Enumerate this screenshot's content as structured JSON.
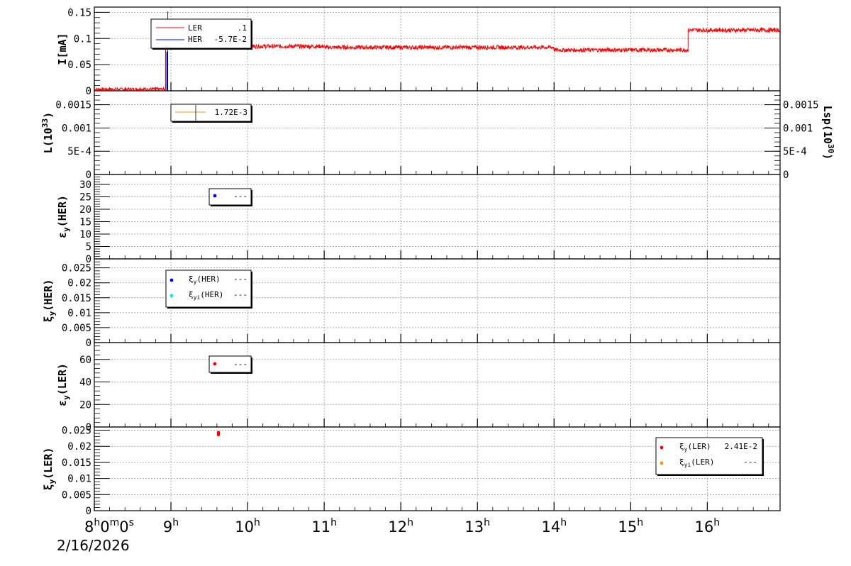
{
  "chart_data": [
    {
      "type": "line",
      "ylabel": "I[mA]",
      "ylim": [
        0,
        0.16
      ],
      "yticks": [
        "0",
        "0.05",
        "0.1",
        "0.15"
      ],
      "ytick_values": [
        0,
        0.05,
        0.1,
        0.15
      ],
      "grid": true,
      "legend": "top-left",
      "series": [
        {
          "name": "LER",
          "value_label": ".1",
          "color": "#ff0000",
          "segments": [
            {
              "x_start": 8.0,
              "x_end": 8.93,
              "mean": 0.003,
              "noise": 0.003
            },
            {
              "x_start": 8.93,
              "x_end": 9.02,
              "mean": 0.083,
              "noise": 0.004
            },
            {
              "x_start": 9.02,
              "x_end": 11.0,
              "mean": 0.085,
              "noise": 0.004
            },
            {
              "x_start": 11.0,
              "x_end": 14.0,
              "mean": 0.083,
              "noise": 0.004
            },
            {
              "x_start": 14.0,
              "x_end": 15.75,
              "mean": 0.078,
              "noise": 0.004
            },
            {
              "x_start": 15.75,
              "x_end": 16.95,
              "mean": 0.116,
              "noise": 0.004
            }
          ]
        },
        {
          "name": "HER",
          "value_label": "-5.7E-2",
          "color": "#0000ff",
          "spike_x": 8.95,
          "spike_top": 0.075
        }
      ]
    },
    {
      "type": "line",
      "ylabel": "L(10",
      "ylabel_sup": "33",
      "ylabel_tail": ")",
      "ylim": [
        0,
        0.0018
      ],
      "yticks": [
        "0",
        "5E-4",
        "0.001",
        "0.0015"
      ],
      "ytick_values": [
        0,
        0.0005,
        0.001,
        0.0015
      ],
      "y2label": "Lsp(10",
      "y2label_sup": "30",
      "y2label_tail": ")",
      "y2ticks": [
        "0",
        "5E-4",
        "0.001",
        "0.0015"
      ],
      "grid": true,
      "series": [
        {
          "name": "",
          "value_label": "1.72E-3",
          "color": "#e8a000"
        }
      ]
    },
    {
      "type": "scatter",
      "ylabel": "ε",
      "ylabel_sub": "y",
      "ylabel_tail": "(HER)",
      "ylim": [
        0,
        34
      ],
      "yticks": [
        "0",
        "5",
        "10",
        "15",
        "20",
        "25",
        "30"
      ],
      "ytick_values": [
        0,
        5,
        10,
        15,
        20,
        25,
        30
      ],
      "grid": true,
      "series": [
        {
          "name": "",
          "value_label": "---",
          "color": "#0000ff",
          "points": []
        }
      ]
    },
    {
      "type": "scatter",
      "ylabel": "ξ",
      "ylabel_sub": "y",
      "ylabel_tail": "(HER)",
      "ylim": [
        0,
        0.028
      ],
      "yticks": [
        "0",
        "0.005",
        "0.01",
        "0.015",
        "0.02",
        "0.025"
      ],
      "ytick_values": [
        0,
        0.005,
        0.01,
        0.015,
        0.02,
        0.025
      ],
      "grid": true,
      "series": [
        {
          "name": "ξ",
          "name_sub": "y",
          "name_tail": "(HER)",
          "value_label": "---",
          "color": "#0000ff",
          "points": []
        },
        {
          "name": "ξ",
          "name_sub": "yi",
          "name_tail": "(HER)",
          "value_label": "---",
          "color": "#00e5ee",
          "points": []
        }
      ]
    },
    {
      "type": "scatter",
      "ylabel": "ε",
      "ylabel_sub": "y",
      "ylabel_tail": "(LER)",
      "ylim": [
        0,
        75
      ],
      "yticks": [
        "0",
        "20",
        "40",
        "60"
      ],
      "ytick_values": [
        0,
        20,
        40,
        60
      ],
      "grid": true,
      "series": [
        {
          "name": "",
          "value_label": "---",
          "color": "#ff0000",
          "points": []
        }
      ]
    },
    {
      "type": "scatter",
      "ylabel": "ξ",
      "ylabel_sub": "y",
      "ylabel_tail": "(LER)",
      "ylim": [
        0,
        0.026
      ],
      "yticks": [
        "0",
        "0.005",
        "0.01",
        "0.015",
        "0.02",
        "0.025"
      ],
      "ytick_values": [
        0,
        0.005,
        0.01,
        0.015,
        0.02,
        0.025
      ],
      "grid": true,
      "series": [
        {
          "name": "ξ",
          "name_sub": "y",
          "name_tail": "(LER)",
          "value_label": "2.41E-2",
          "color": "#ff0000",
          "points": [
            [
              9.62,
              0.0236
            ],
            [
              9.62,
              0.024
            ],
            [
              9.62,
              0.0243
            ]
          ]
        },
        {
          "name": "ξ",
          "name_sub": "yi",
          "name_tail": "(LER)",
          "value_label": "---",
          "color": "#e8a000",
          "points": []
        }
      ]
    }
  ],
  "x_axis": {
    "xlim": [
      8.0,
      16.95
    ],
    "ticks": [
      {
        "x": 8,
        "label": "8",
        "sup": "h",
        "rest": "0",
        "sup2": "m",
        "rest2": "0",
        "sup3": "s"
      },
      {
        "x": 9,
        "label": "9",
        "sup": "h"
      },
      {
        "x": 10,
        "label": "10",
        "sup": "h"
      },
      {
        "x": 11,
        "label": "11",
        "sup": "h"
      },
      {
        "x": 12,
        "label": "12",
        "sup": "h"
      },
      {
        "x": 13,
        "label": "13",
        "sup": "h"
      },
      {
        "x": 14,
        "label": "14",
        "sup": "h"
      },
      {
        "x": 15,
        "label": "15",
        "sup": "h"
      },
      {
        "x": 16,
        "label": "16",
        "sup": "h"
      }
    ],
    "date": "2/16/2026"
  }
}
